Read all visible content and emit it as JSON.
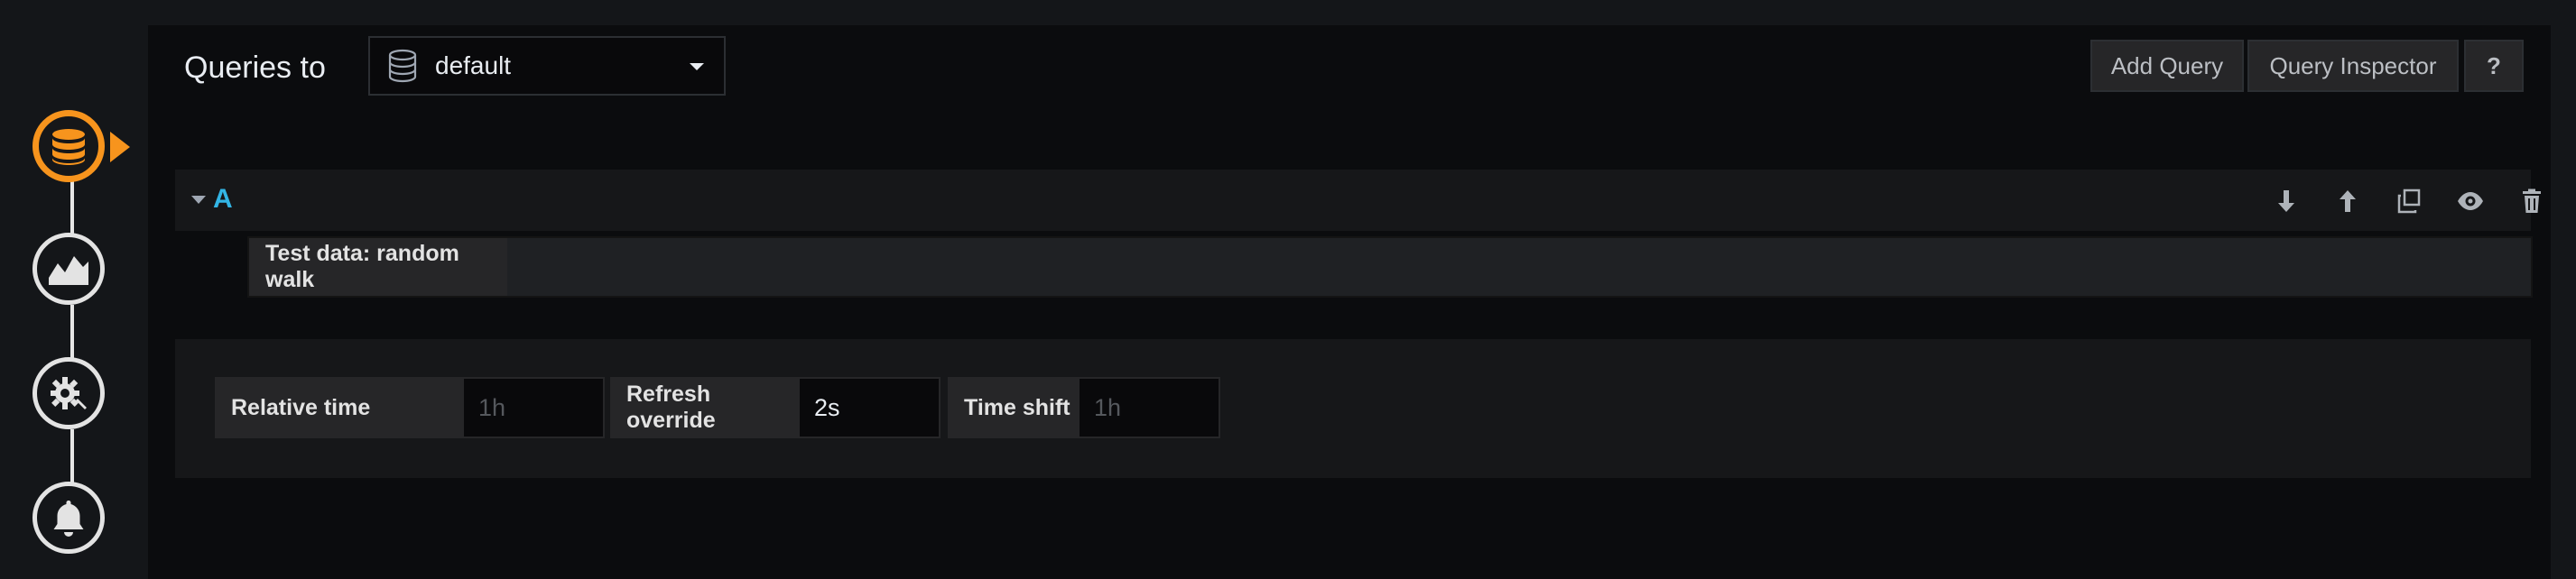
{
  "header": {
    "title": "Queries to",
    "datasource": {
      "selected": "default"
    },
    "buttons": {
      "add_query": "Add Query",
      "query_inspector": "Query Inspector",
      "help": "?"
    }
  },
  "sidebar": {
    "steps": [
      {
        "name": "queries",
        "icon": "database-icon",
        "active": true
      },
      {
        "name": "visualization",
        "icon": "chart-icon",
        "active": false
      },
      {
        "name": "general",
        "icon": "gear-icon",
        "active": false
      },
      {
        "name": "alert",
        "icon": "bell-icon",
        "active": false
      }
    ]
  },
  "query_row": {
    "ref_id": "A",
    "type_label": "Test data: random walk",
    "actions": [
      "arrow-down-icon",
      "arrow-up-icon",
      "duplicate-icon",
      "eye-icon",
      "trash-icon"
    ]
  },
  "options": {
    "relative_time": {
      "label": "Relative time",
      "placeholder": "1h",
      "value": ""
    },
    "refresh_override": {
      "label": "Refresh override",
      "value": "2s"
    },
    "time_shift": {
      "label": "Time shift",
      "placeholder": "1h",
      "value": ""
    }
  },
  "colors": {
    "accent": "#f7941d",
    "ref_id": "#33b5e5",
    "background": "#0b0c0e"
  }
}
